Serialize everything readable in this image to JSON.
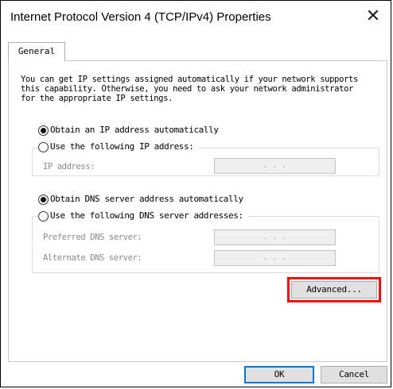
{
  "window": {
    "title": "Internet Protocol Version 4 (TCP/IPv4) Properties",
    "close_glyph": "✕"
  },
  "tabs": [
    {
      "label": "General"
    }
  ],
  "general": {
    "description": "You can get IP settings assigned automatically if your network supports this capability. Otherwise, you need to ask your network administrator for the appropriate IP settings.",
    "ip_mode": {
      "auto_label": "Obtain an IP address automatically",
      "manual_label": "Use the following IP address:",
      "selected": "auto",
      "ip_address_label": "IP address:",
      "ip_address_value": ". . ."
    },
    "dns_mode": {
      "auto_label": "Obtain DNS server address automatically",
      "manual_label": "Use the following DNS server addresses:",
      "selected": "auto",
      "preferred_label": "Preferred DNS server:",
      "preferred_value": ". . .",
      "alternate_label": "Alternate DNS server:",
      "alternate_value": ". . ."
    },
    "advanced_label": "Advanced..."
  },
  "footer": {
    "ok_label": "OK",
    "cancel_label": "Cancel"
  },
  "colors": {
    "highlight": "#ff0000",
    "default_button_border": "#0078d7",
    "disabled_text": "#8a8a8a"
  }
}
